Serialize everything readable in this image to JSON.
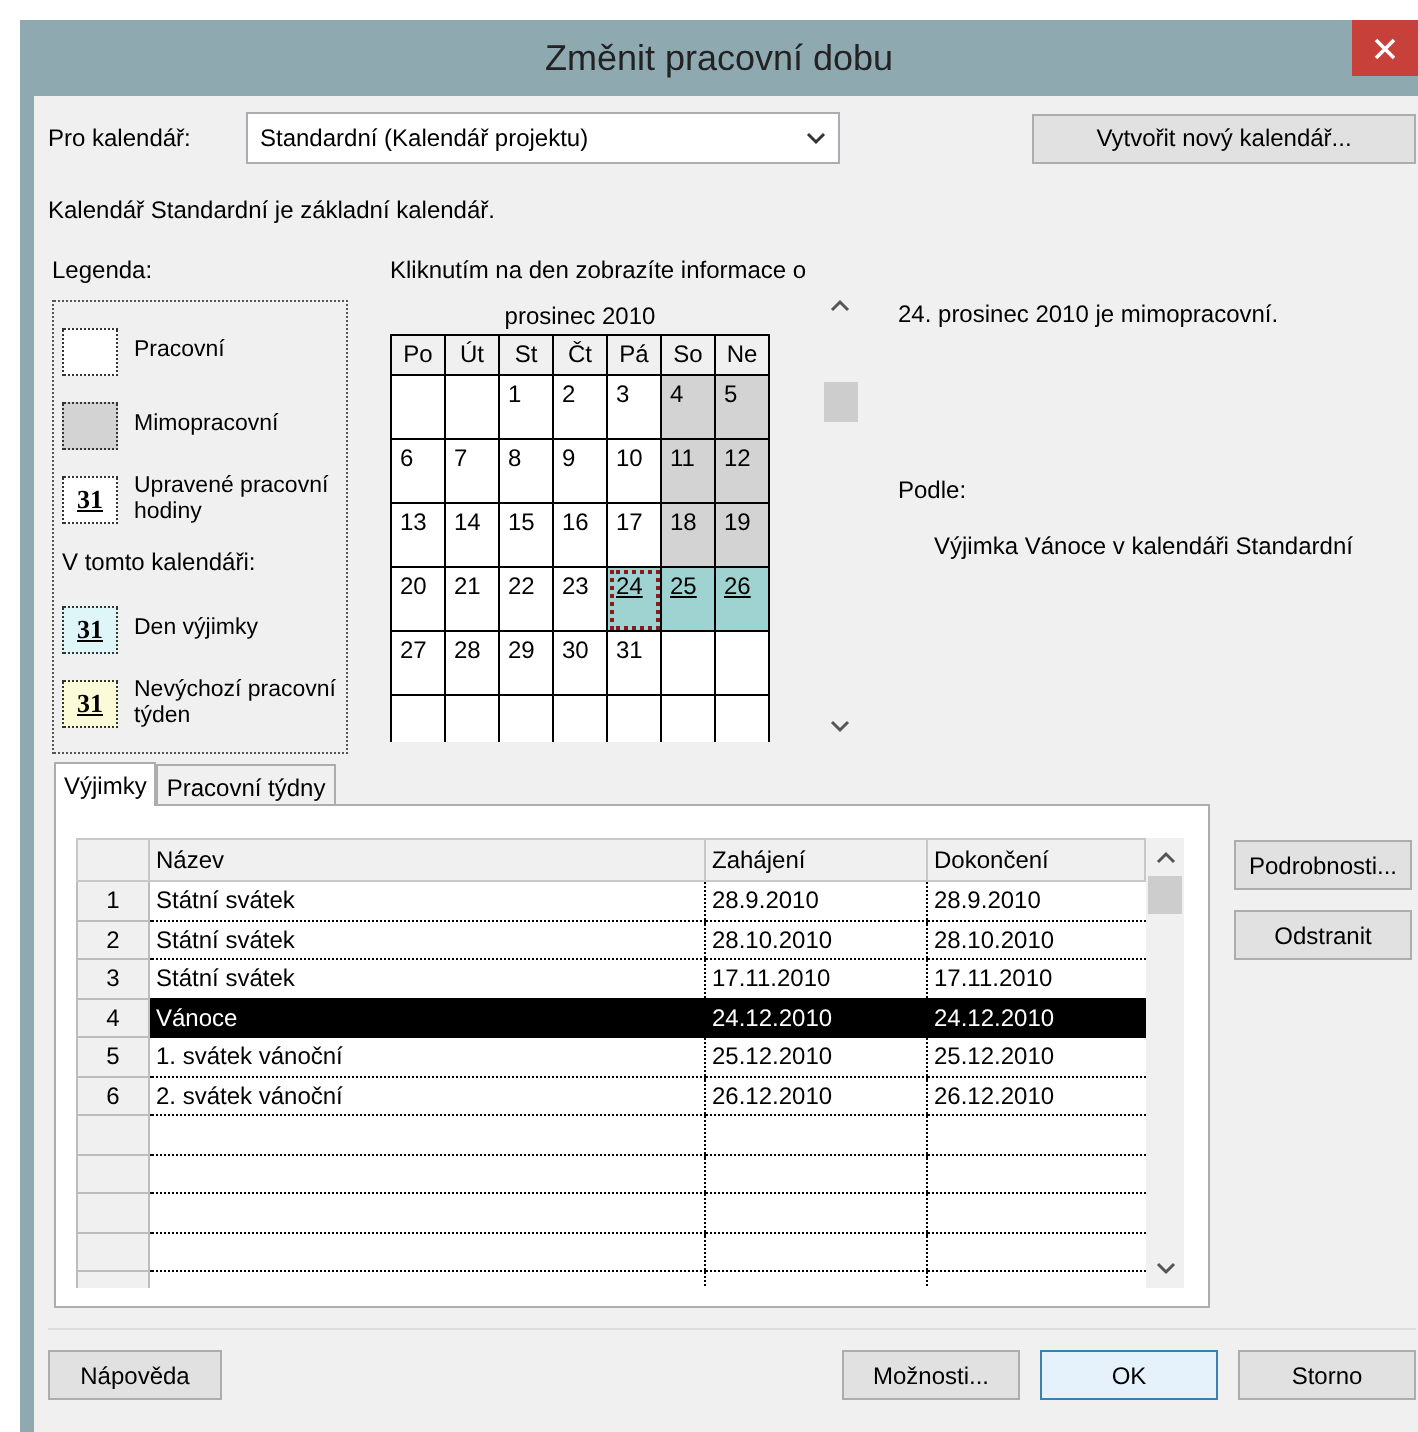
{
  "window": {
    "title": "Změnit pracovní dobu"
  },
  "calendar_select": {
    "label": "Pro kalendář:",
    "value": "Standardní (Kalendář projektu)"
  },
  "new_calendar_button": "Vytvořit nový kalendář...",
  "calendar_note": "Kalendář Standardní je základní kalendář.",
  "legend": {
    "title": "Legenda:",
    "items": [
      {
        "kind": "working",
        "label": "Pracovní"
      },
      {
        "kind": "nonworking",
        "label": "Mimopracovní"
      },
      {
        "kind": "edited",
        "swatch_text": "31",
        "label": "Upravené pracovní hodiny"
      },
      {
        "kind": "heading",
        "label": "V tomto kalendáři:"
      },
      {
        "kind": "exception",
        "swatch_text": "31",
        "label": "Den výjimky"
      },
      {
        "kind": "nonstandard",
        "swatch_text": "31",
        "label": "Nevýchozí pracovní týden"
      }
    ]
  },
  "calendar": {
    "hint": "Kliknutím na den zobrazíte informace o",
    "month": "prosinec 2010",
    "weekdays": [
      "Po",
      "Út",
      "St",
      "Čt",
      "Pá",
      "So",
      "Ne"
    ],
    "weeks": [
      [
        {
          "kind": "blank",
          "selected": false
        },
        {
          "kind": "blank",
          "selected": false
        },
        {
          "day": "1",
          "kind": "working",
          "selected": false
        },
        {
          "day": "2",
          "kind": "working",
          "selected": false
        },
        {
          "day": "3",
          "kind": "working",
          "selected": false
        },
        {
          "day": "4",
          "kind": "nonworking",
          "selected": false
        },
        {
          "day": "5",
          "kind": "nonworking",
          "selected": false
        }
      ],
      [
        {
          "day": "6",
          "kind": "working",
          "selected": false
        },
        {
          "day": "7",
          "kind": "working",
          "selected": false
        },
        {
          "day": "8",
          "kind": "working",
          "selected": false
        },
        {
          "day": "9",
          "kind": "working",
          "selected": false
        },
        {
          "day": "10",
          "kind": "working",
          "selected": false
        },
        {
          "day": "11",
          "kind": "nonworking",
          "selected": false
        },
        {
          "day": "12",
          "kind": "nonworking",
          "selected": false
        }
      ],
      [
        {
          "day": "13",
          "kind": "working",
          "selected": false
        },
        {
          "day": "14",
          "kind": "working",
          "selected": false
        },
        {
          "day": "15",
          "kind": "working",
          "selected": false
        },
        {
          "day": "16",
          "kind": "working",
          "selected": false
        },
        {
          "day": "17",
          "kind": "working",
          "selected": false
        },
        {
          "day": "18",
          "kind": "nonworking",
          "selected": false
        },
        {
          "day": "19",
          "kind": "nonworking",
          "selected": false
        }
      ],
      [
        {
          "day": "20",
          "kind": "working",
          "selected": false
        },
        {
          "day": "21",
          "kind": "working",
          "selected": false
        },
        {
          "day": "22",
          "kind": "working",
          "selected": false
        },
        {
          "day": "23",
          "kind": "working",
          "selected": false
        },
        {
          "day": "24",
          "kind": "exception",
          "selected": true
        },
        {
          "day": "25",
          "kind": "exception",
          "selected": false
        },
        {
          "day": "26",
          "kind": "exception",
          "selected": false
        }
      ],
      [
        {
          "day": "27",
          "kind": "working",
          "selected": false
        },
        {
          "day": "28",
          "kind": "working",
          "selected": false
        },
        {
          "day": "29",
          "kind": "working",
          "selected": false
        },
        {
          "day": "30",
          "kind": "working",
          "selected": false
        },
        {
          "day": "31",
          "kind": "working",
          "selected": false
        },
        {
          "kind": "blank",
          "selected": false
        },
        {
          "kind": "blank",
          "selected": false
        }
      ],
      [
        {
          "kind": "blank",
          "selected": false
        },
        {
          "kind": "blank",
          "selected": false
        },
        {
          "kind": "blank",
          "selected": false
        },
        {
          "kind": "blank",
          "selected": false
        },
        {
          "kind": "blank",
          "selected": false
        },
        {
          "kind": "blank",
          "selected": false
        },
        {
          "kind": "blank",
          "selected": false
        }
      ]
    ]
  },
  "info": {
    "status": "24. prosinec 2010 je mimopracovní.",
    "by_label": "Podle:",
    "by_value": "Výjimka Vánoce v kalendáři Standardní"
  },
  "tabs": [
    {
      "label": "Výjimky",
      "selected": true
    },
    {
      "label": "Pracovní týdny",
      "selected": false
    }
  ],
  "exceptions": {
    "columns": [
      "Název",
      "Zahájení",
      "Dokončení"
    ],
    "rows": [
      {
        "number": "1",
        "name": "Státní svátek",
        "start": "28.9.2010",
        "finish": "28.9.2010",
        "selected": false
      },
      {
        "number": "2",
        "name": "Státní svátek",
        "start": "28.10.2010",
        "finish": "28.10.2010",
        "selected": false
      },
      {
        "number": "3",
        "name": "Státní svátek",
        "start": "17.11.2010",
        "finish": "17.11.2010",
        "selected": false
      },
      {
        "number": "4",
        "name": "Vánoce",
        "start": "24.12.2010",
        "finish": "24.12.2010",
        "selected": true
      },
      {
        "number": "5",
        "name": "1. svátek vánoční",
        "start": "25.12.2010",
        "finish": "25.12.2010",
        "selected": false
      },
      {
        "number": "6",
        "name": "2. svátek vánoční",
        "start": "26.12.2010",
        "finish": "26.12.2010",
        "selected": false
      }
    ]
  },
  "side_buttons": [
    "Podrobnosti...",
    "Odstranit"
  ],
  "footer_buttons": [
    {
      "label": "Nápověda",
      "default": false
    },
    {
      "label": "Možnosti...",
      "default": false
    },
    {
      "label": "OK",
      "default": true
    },
    {
      "label": "Storno",
      "default": false
    }
  ]
}
